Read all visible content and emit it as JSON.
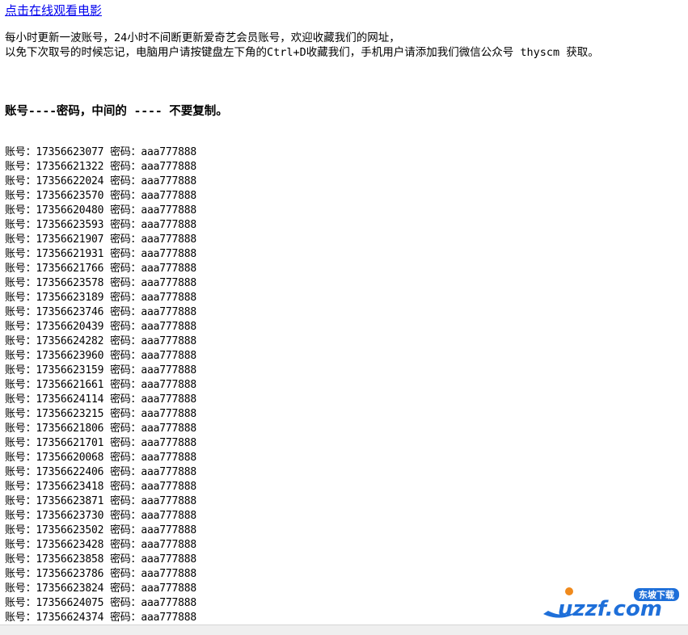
{
  "top_link": "点击在线观看电影",
  "intro": {
    "line1": "每小时更新一波账号，24小时不间断更新爱奇艺会员账号，欢迎收藏我们的网址，",
    "line2": "以免下次取号的时候忘记，电脑用户请按键盘左下角的Ctrl+D收藏我们，手机用户请添加我们微信公众号 thyscm 获取。"
  },
  "heading": "账号----密码，中间的 ---- 不要复制。",
  "account_label": "账号：",
  "password_label": "密码：",
  "accounts": [
    {
      "user": "17356623077",
      "pass": "aaa777888"
    },
    {
      "user": "17356621322",
      "pass": "aaa777888"
    },
    {
      "user": "17356622024",
      "pass": "aaa777888"
    },
    {
      "user": "17356623570",
      "pass": "aaa777888"
    },
    {
      "user": "17356620480",
      "pass": "aaa777888"
    },
    {
      "user": "17356623593",
      "pass": "aaa777888"
    },
    {
      "user": "17356621907",
      "pass": "aaa777888"
    },
    {
      "user": "17356621931",
      "pass": "aaa777888"
    },
    {
      "user": "17356621766",
      "pass": "aaa777888"
    },
    {
      "user": "17356623578",
      "pass": "aaa777888"
    },
    {
      "user": "17356623189",
      "pass": "aaa777888"
    },
    {
      "user": "17356623746",
      "pass": "aaa777888"
    },
    {
      "user": "17356620439",
      "pass": "aaa777888"
    },
    {
      "user": "17356624282",
      "pass": "aaa777888"
    },
    {
      "user": "17356623960",
      "pass": "aaa777888"
    },
    {
      "user": "17356623159",
      "pass": "aaa777888"
    },
    {
      "user": "17356621661",
      "pass": "aaa777888"
    },
    {
      "user": "17356624114",
      "pass": "aaa777888"
    },
    {
      "user": "17356623215",
      "pass": "aaa777888"
    },
    {
      "user": "17356621806",
      "pass": "aaa777888"
    },
    {
      "user": "17356621701",
      "pass": "aaa777888"
    },
    {
      "user": "17356620068",
      "pass": "aaa777888"
    },
    {
      "user": "17356622406",
      "pass": "aaa777888"
    },
    {
      "user": "17356623418",
      "pass": "aaa777888"
    },
    {
      "user": "17356623871",
      "pass": "aaa777888"
    },
    {
      "user": "17356623730",
      "pass": "aaa777888"
    },
    {
      "user": "17356623502",
      "pass": "aaa777888"
    },
    {
      "user": "17356623428",
      "pass": "aaa777888"
    },
    {
      "user": "17356623858",
      "pass": "aaa777888"
    },
    {
      "user": "17356623786",
      "pass": "aaa777888"
    },
    {
      "user": "17356623824",
      "pass": "aaa777888"
    },
    {
      "user": "17356624075",
      "pass": "aaa777888"
    },
    {
      "user": "17356624374",
      "pass": "aaa777888"
    }
  ],
  "watermark": {
    "brand": "uzzf.com",
    "badge": "东坡下载",
    "colors": {
      "blue": "#1e6fd9",
      "orange": "#f08a1c"
    }
  }
}
